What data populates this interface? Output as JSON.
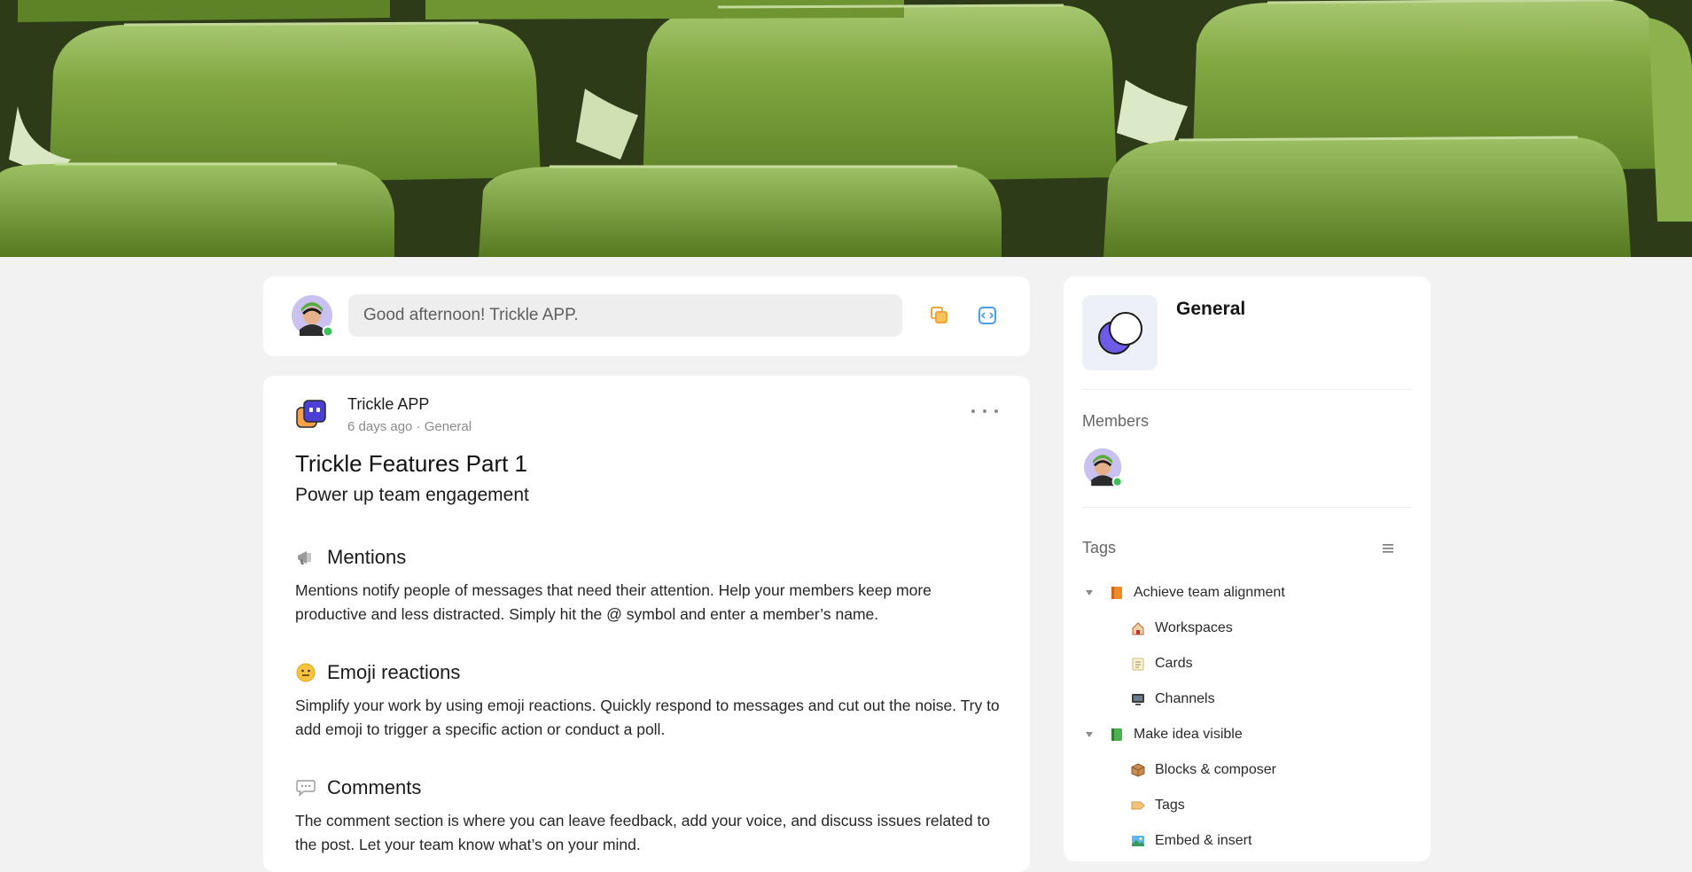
{
  "composer": {
    "placeholder": "Good afternoon! Trickle APP."
  },
  "post": {
    "author": "Trickle APP",
    "meta": "6 days ago · General",
    "title": "Trickle Features Part 1",
    "subtitle": "Power up team engagement",
    "sections": [
      {
        "icon": "megaphone-icon",
        "heading": "Mentions",
        "body": "Mentions notify people of messages that need their attention. Help your members keep more productive and less distracted. Simply hit the @ symbol and enter a member’s name."
      },
      {
        "icon": "smiley-emoji-icon",
        "heading": "Emoji reactions",
        "body": "Simplify your work by using emoji reactions. Quickly respond to messages and cut out the noise. Try to add emoji to trigger a specific action or conduct a poll."
      },
      {
        "icon": "speech-bubble-icon",
        "heading": "Comments",
        "body": "The comment section is where you can leave feedback, add your voice, and discuss issues related to the post. Let your team know what’s on your mind."
      }
    ]
  },
  "sidebar": {
    "channel_name": "General",
    "members_label": "Members",
    "tags_label": "Tags",
    "tags": [
      {
        "label": "Achieve team alignment",
        "icon": "orange-book-icon",
        "children": [
          {
            "label": "Workspaces",
            "icon": "house-icon"
          },
          {
            "label": "Cards",
            "icon": "memo-icon"
          },
          {
            "label": "Channels",
            "icon": "computer-icon"
          }
        ]
      },
      {
        "label": "Make idea visible",
        "icon": "green-book-icon",
        "children": [
          {
            "label": "Blocks & composer",
            "icon": "package-icon"
          },
          {
            "label": "Tags",
            "icon": "label-icon"
          },
          {
            "label": "Embed & insert",
            "icon": "picture-icon"
          }
        ]
      }
    ]
  },
  "colors": {
    "online": "#3cc15a",
    "accent_purple": "#5b4fe0",
    "banner_green": "#7fa33f"
  }
}
